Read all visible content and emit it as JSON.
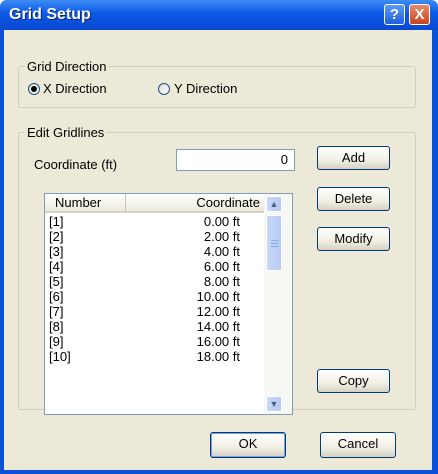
{
  "window": {
    "title": "Grid Setup",
    "help_label": "?",
    "close_label": "X"
  },
  "grid_direction": {
    "legend": "Grid Direction",
    "options": [
      {
        "label": "X Direction",
        "checked": true
      },
      {
        "label": "Y Direction",
        "checked": false
      }
    ]
  },
  "edit_gridlines": {
    "legend": "Edit Gridlines",
    "coordinate_label": "Coordinate (ft)",
    "coordinate_value": "0",
    "table": {
      "headers": [
        "Number",
        "Coordinate"
      ],
      "rows": [
        [
          "[1]",
          "0.00 ft"
        ],
        [
          "[2]",
          "2.00 ft"
        ],
        [
          "[3]",
          "4.00 ft"
        ],
        [
          "[4]",
          "6.00 ft"
        ],
        [
          "[5]",
          "8.00 ft"
        ],
        [
          "[6]",
          "10.00 ft"
        ],
        [
          "[7]",
          "12.00 ft"
        ],
        [
          "[8]",
          "14.00 ft"
        ],
        [
          "[9]",
          "16.00 ft"
        ],
        [
          "[10]",
          "18.00 ft"
        ]
      ]
    },
    "buttons": {
      "add": "Add",
      "delete": "Delete",
      "modify": "Modify",
      "copy": "Copy"
    }
  },
  "footer": {
    "ok": "OK",
    "cancel": "Cancel"
  }
}
